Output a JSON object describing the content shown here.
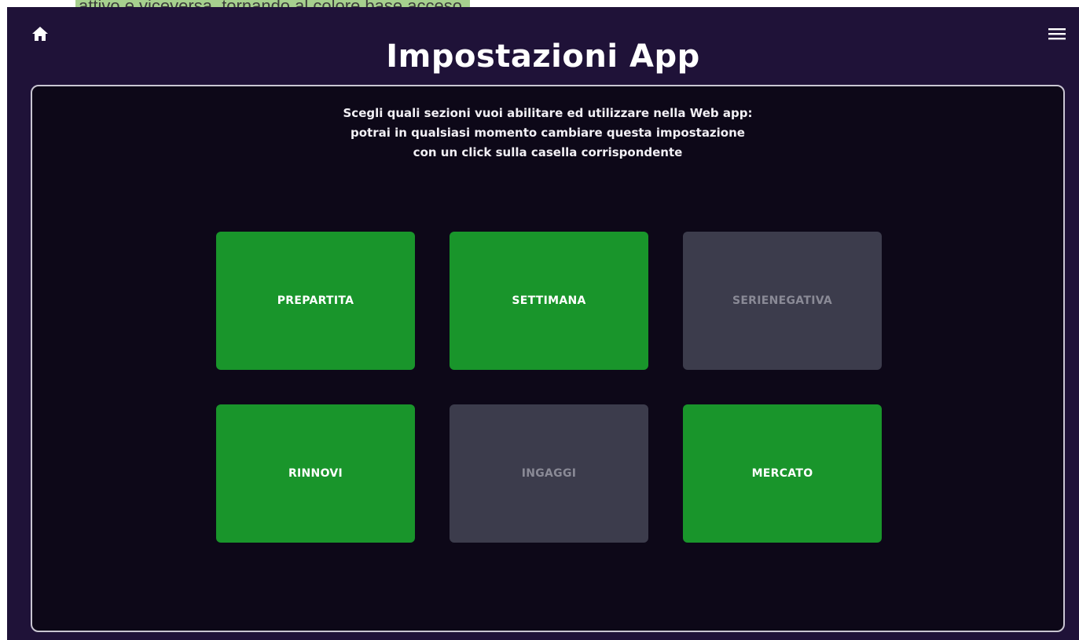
{
  "caption": {
    "text": "attivo e viceversa, tornando al colore base acceso."
  },
  "header": {
    "home_icon": "home-icon",
    "menu_icon": "hamburger-menu-icon",
    "title": "Impostazioni App"
  },
  "panel": {
    "instructions": [
      "Scegli quali sezioni vuoi abilitare ed utilizzare nella Web app:",
      "potrai in qualsiasi momento cambiare questa impostazione",
      "con un click sulla casella corrispondente"
    ]
  },
  "sections": [
    {
      "label": "PREPARTITA",
      "enabled": true
    },
    {
      "label": "SETTIMANA",
      "enabled": true
    },
    {
      "label": "SERIENEGATIVA",
      "enabled": false
    },
    {
      "label": "RINNOVI",
      "enabled": true
    },
    {
      "label": "INGAGGI",
      "enabled": false
    },
    {
      "label": "MERCATO",
      "enabled": true
    }
  ],
  "colors": {
    "background": "#1f1238",
    "panel": "#0d0818",
    "enabled": "#19952b",
    "disabled": "#3c3c4c",
    "disabled_text": "#8a8a96"
  }
}
